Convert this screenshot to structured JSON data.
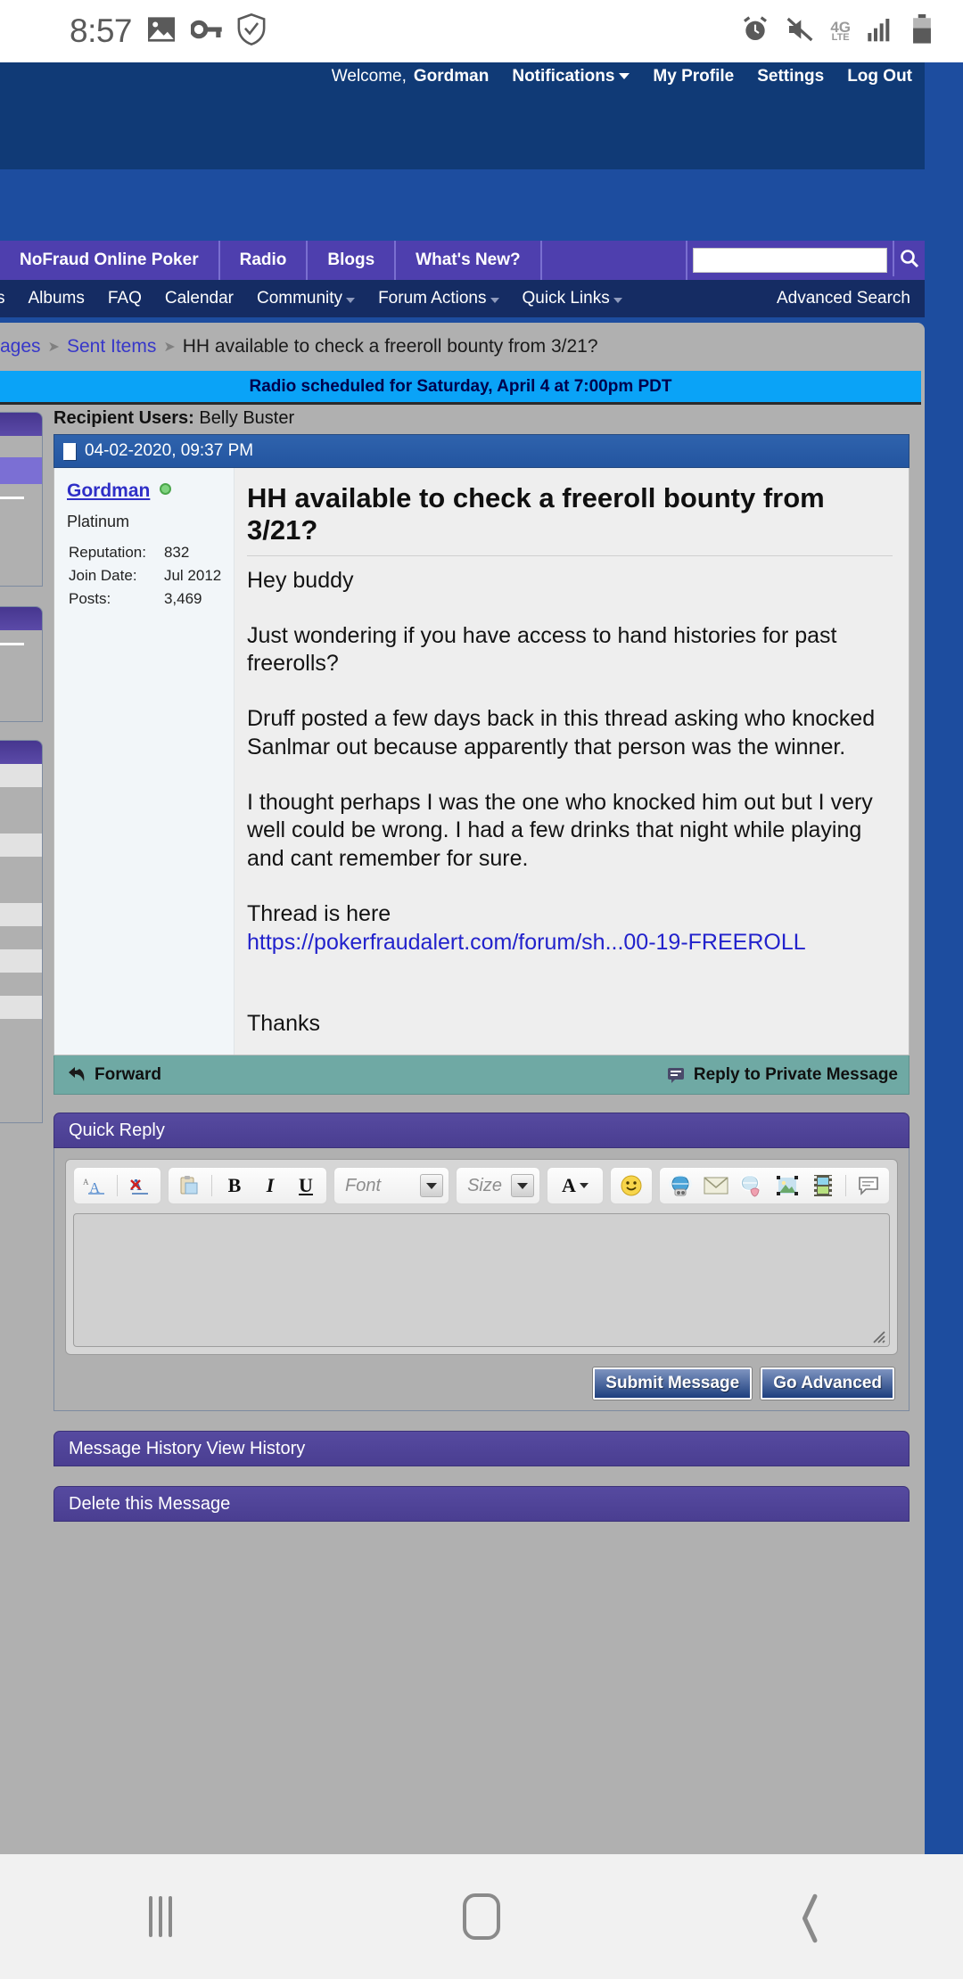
{
  "status_bar": {
    "time": "8:57",
    "left_icons": [
      "photo-icon",
      "key-icon",
      "shield-check-icon"
    ],
    "right_icons": [
      "alarm-icon",
      "mute-icon",
      "signal-bars-icon",
      "battery-icon"
    ],
    "network": "4G",
    "network_sub": "LTE"
  },
  "header": {
    "welcome_prefix": "Welcome,",
    "username": "Gordman",
    "links": [
      "Notifications",
      "My Profile",
      "Settings",
      "Log Out"
    ]
  },
  "nav_tabs": [
    {
      "label": "NoFraud Online Poker"
    },
    {
      "label": "Radio"
    },
    {
      "label": "Blogs"
    },
    {
      "label": "What's New?"
    }
  ],
  "search": {
    "value": "",
    "placeholder": "",
    "advanced_label": "Advanced Search",
    "icon": "search-icon"
  },
  "sub_nav": [
    {
      "label": "s",
      "caret": false
    },
    {
      "label": "Albums",
      "caret": false
    },
    {
      "label": "FAQ",
      "caret": false
    },
    {
      "label": "Calendar",
      "caret": false
    },
    {
      "label": "Community",
      "caret": true
    },
    {
      "label": "Forum Actions",
      "caret": true
    },
    {
      "label": "Quick Links",
      "caret": true
    }
  ],
  "breadcrumb": {
    "item1": "ages",
    "item2": "Sent Items",
    "current": "HH available to check a freeroll bounty from 3/21?"
  },
  "notice": "Radio scheduled for Saturday, April 4 at 7:00pm PDT",
  "message": {
    "recipients_label": "Recipient Users:",
    "recipients_value": "Belly Buster",
    "timestamp": "04-02-2020, 09:37 PM",
    "author": {
      "name": "Gordman",
      "rank": "Platinum",
      "stats": [
        {
          "key": "Reputation:",
          "value": "832"
        },
        {
          "key": "Join Date:",
          "value": "Jul 2012"
        },
        {
          "key": "Posts:",
          "value": "3,469"
        }
      ]
    },
    "title": "HH available to check a freeroll bounty from 3/21?",
    "paragraphs": [
      "Hey buddy",
      "Just wondering if you have access to hand histories for past freerolls?",
      "Druff posted a few days back in this thread asking who knocked Sanlmar out because apparently that person was the winner.",
      "I thought perhaps I was the one who knocked him out but I very well could be wrong. I had a few drinks that night while playing and cant remember for sure."
    ],
    "link_intro": "Thread is here",
    "link_text": "https://pokerfraudalert.com/forum/sh...00-19-FREEROLL",
    "closing": "Thanks",
    "footer": {
      "forward_label": "Forward",
      "forward_icon": "reply-arrow-icon",
      "reply_label": "Reply to Private Message",
      "reply_icon": "speech-bubble-icon"
    }
  },
  "quick_reply": {
    "title": "Quick Reply",
    "toolbar": {
      "group1": [
        "remove-formatting-icon",
        "undo-formatting-icon"
      ],
      "group2": [
        "paste-icon",
        "bold-icon",
        "italic-icon",
        "underline-icon"
      ],
      "font_placeholder": "Font",
      "size_placeholder": "Size",
      "color_icon": "font-color-icon",
      "smiley_icon": "smiley-icon",
      "group3": [
        "link-icon",
        "email-icon",
        "unlink-icon",
        "image-icon",
        "video-icon",
        "quote-icon"
      ]
    },
    "textarea_value": "",
    "textarea_placeholder": "",
    "submit_label": "Submit Message",
    "advanced_label": "Go Advanced"
  },
  "panels": [
    {
      "label": "Message History View History"
    },
    {
      "label": "Delete this Message"
    }
  ],
  "android_nav": {
    "recents": "recents-icon",
    "home": "home-icon",
    "back": "back-icon"
  },
  "colors": {
    "header_dark": "#103a76",
    "nav_purple": "#4e3fae",
    "subnav": "#152c63",
    "notice_blue": "#0aa3f7",
    "panel_gray": "#b0b0b0",
    "msg_header": "#2f63ad",
    "footer_teal": "#6fa9a4",
    "link_blue": "#2222cc",
    "right_gutter": "#1d4d9f"
  }
}
